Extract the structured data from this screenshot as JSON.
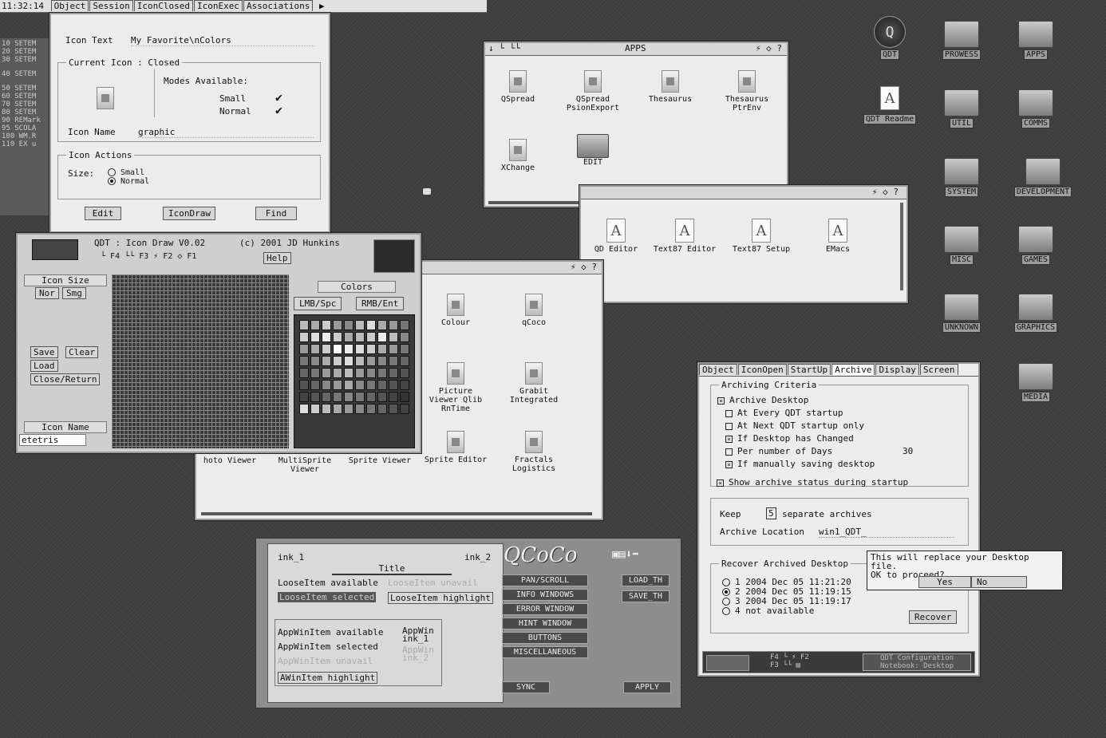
{
  "topbar": {
    "clock": "11:32:14",
    "tabs": [
      "Object",
      "Session",
      "IconClosed",
      "IconExec",
      "Associations"
    ]
  },
  "left_strip": [
    "10 SETEM",
    "20 SETEM",
    "30 SETEM",
    "40 SETEM",
    "50 SETEM",
    "60 SETEM",
    "70 SETEM",
    "80 SETEM",
    "90 REMark",
    "95 SCOLA",
    "100 WM.R",
    "110 EX u"
  ],
  "icon_editor": {
    "icon_text_label": "Icon Text",
    "icon_text_value": "My Favorite\\nColors",
    "current_icon_group": "Current Icon : Closed",
    "modes_label": "Modes Available:",
    "mode_small": "Small",
    "mode_normal": "Normal",
    "icon_name_label": "Icon Name",
    "icon_name_value": "graphic",
    "icon_actions_group": "Icon Actions",
    "size_label": "Size:",
    "size_small": "Small",
    "size_normal": "Normal",
    "edit_btn": "Edit",
    "icondraw_btn": "IconDraw",
    "find_btn": "Find"
  },
  "icon_draw": {
    "title": "QDT : Icon Draw V0.02",
    "copyright": "(c) 2001 JD Hunkins",
    "help": "Help",
    "toolbar": [
      "F4",
      "F3",
      "F2",
      "F1"
    ],
    "icon_size_label": "Icon Size",
    "nor": "Nor",
    "smg": "Smg",
    "save": "Save",
    "clear": "Clear",
    "load": "Load",
    "close_return": "Close/Return",
    "icon_name_label": "Icon Name",
    "icon_name_value": "etetris",
    "colors_label": "Colors",
    "lmb": "LMB/Spc",
    "rmb": "RMB/Ent"
  },
  "apps_window": {
    "title": "APPS",
    "items": [
      "QSpread",
      "QSpread PsionExport",
      "Thesaurus",
      "Thesaurus PtrEnv",
      "XChange",
      "EDIT"
    ]
  },
  "editors_window": {
    "items": [
      "QD Editor",
      "Text87 Editor",
      "Text87 Setup",
      "EMacs"
    ]
  },
  "graphics_window": {
    "items": [
      "Colour",
      "qCoco",
      "Picture Viewer Qlib RnTime",
      "Grabit Integrated",
      "hoto Viewer",
      "MultiSprite Viewer",
      "Sprite Viewer",
      "Sprite Editor",
      "Fractals Logistics"
    ]
  },
  "desktop_icons": [
    "QDT",
    "PROWESS",
    "APPS",
    "QDT Readme",
    "UTIL",
    "COMMS",
    "SYSTEM",
    "DEVELOPMENT",
    "MISC",
    "GAMES",
    "UNKNOWN",
    "GRAPHICS",
    "MEDIA"
  ],
  "qcoco": {
    "ink1": "ink_1",
    "ink2": "ink_2",
    "title": "Title",
    "loose_available": "LooseItem available",
    "loose_unavail": "LooseItem unavail",
    "loose_selected": "LooseItem selected",
    "loose_highlight": "LooseItem highlight",
    "app_available": "AppWinItem available",
    "app_selected": "AppWinItem selected",
    "app_unavail": "AppWinItem unavail",
    "awin_highlight": "AWinItem highlight",
    "appwin_ink1": "AppWin ink_1",
    "appwin_ink2": "AppWin ink_2",
    "logo": "QCoCo",
    "menu": [
      "PAN/SCROLL",
      "INFO WINDOWS",
      "ERROR WINDOW",
      "HINT WINDOW",
      "BUTTONS",
      "MISCELLANEOUS"
    ],
    "load_th": "LOAD_TH",
    "save_th": "SAVE_TH",
    "sync": "SYNC",
    "apply": "APPLY"
  },
  "config": {
    "tabs": [
      "Object",
      "IconOpen",
      "StartUp",
      "Archive",
      "Display",
      "Screen"
    ],
    "criteria_group": "Archiving Criteria",
    "archive_desktop": "Archive Desktop",
    "opts": [
      "At Every QDT startup",
      "At Next QDT startup only",
      "If Desktop has Changed",
      "Per number of Days",
      "If manually saving desktop"
    ],
    "days_value": "30",
    "show_status": "Show archive status during startup",
    "keep_label": "Keep",
    "keep_value": "5",
    "keep_suffix": "separate archives",
    "location_label": "Archive Location",
    "location_value": "win1_QDT_",
    "recover_group": "Recover Archived Desktop",
    "archives": [
      "1  2004 Dec 05 11:21:20",
      "2  2004 Dec 05 11:19:15",
      "3  2004 Dec 05 11:19:17",
      "4  not available"
    ],
    "recover_btn": "Recover",
    "footer_keys": [
      "F4",
      "F3",
      "F2"
    ],
    "footer_title": "QDT Configuration",
    "footer_sub": "Notebook: Desktop"
  },
  "dialog": {
    "line1": "This will replace your Desktop file.",
    "line2": "OK to proceed?",
    "yes": "Yes",
    "no": "No"
  }
}
